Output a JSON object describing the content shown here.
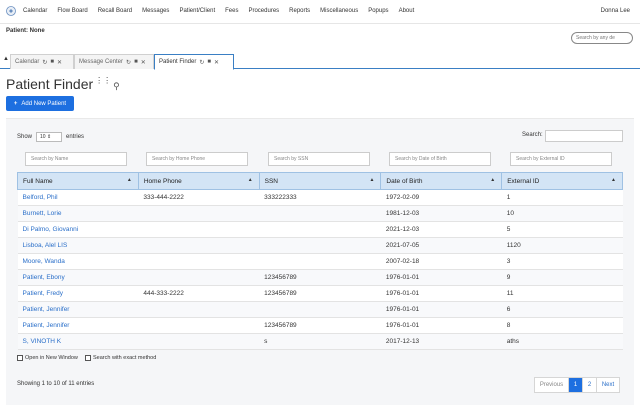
{
  "nav": {
    "items": [
      "Calendar",
      "Flow Board",
      "Recall Board",
      "Messages",
      "Patient/Client",
      "Fees",
      "Procedures",
      "Reports",
      "Miscellaneous",
      "Popups",
      "About"
    ],
    "user": "Donna Lee"
  },
  "patient_bar": {
    "label": "Patient: None",
    "search_placeholder": "Search by any de"
  },
  "tabs": [
    {
      "label": "Calendar",
      "active": false
    },
    {
      "label": "Message Center",
      "active": false
    },
    {
      "label": "Patient Finder",
      "active": true
    }
  ],
  "page": {
    "title": "Patient Finder",
    "add_button": "Add New Patient"
  },
  "table_controls": {
    "show_label": "Show",
    "show_value": "10",
    "entries_label": "entries",
    "search_label": "Search:"
  },
  "filters": [
    "Search by Name",
    "Search by Home Phone",
    "Search by SSN",
    "Search by Date of Birth",
    "Search by External ID"
  ],
  "columns": [
    "Full Name",
    "Home Phone",
    "SSN",
    "Date of Birth",
    "External ID"
  ],
  "rows": [
    [
      "Belford, Phil",
      "333-444-2222",
      "333222333",
      "1972-02-09",
      "1"
    ],
    [
      "Burnett, Lorie",
      "",
      "",
      "1981-12-03",
      "10"
    ],
    [
      "Di Palmo, Giovanni",
      "",
      "",
      "2021-12-03",
      "5"
    ],
    [
      "Lisboa, Alel LIS",
      "",
      "",
      "2021-07-05",
      "1120"
    ],
    [
      "Moore, Wanda",
      "",
      "",
      "2007-02-18",
      "3"
    ],
    [
      "Patient, Ebony",
      "",
      "123456789",
      "1976-01-01",
      "9"
    ],
    [
      "Patient, Fredy",
      "444-333-2222",
      "123456789",
      "1976-01-01",
      "11"
    ],
    [
      "Patient, Jennifer",
      "",
      "",
      "1976-01-01",
      "6"
    ],
    [
      "Patient, Jennifer",
      "",
      "123456789",
      "1976-01-01",
      "8"
    ],
    [
      "S, VINOTH K",
      "",
      "s",
      "2017-12-13",
      "aths"
    ]
  ],
  "options": {
    "open_new_window": "Open in New Window",
    "exact_method": "Search with exact method"
  },
  "footer": {
    "info": "Showing 1 to 10 of 11 entries",
    "pagination": [
      "Previous",
      "1",
      "2",
      "Next"
    ]
  },
  "colors": {
    "accent": "#1d6fe0",
    "header_bg": "#d3e4f5",
    "link": "#2a6fc9"
  }
}
